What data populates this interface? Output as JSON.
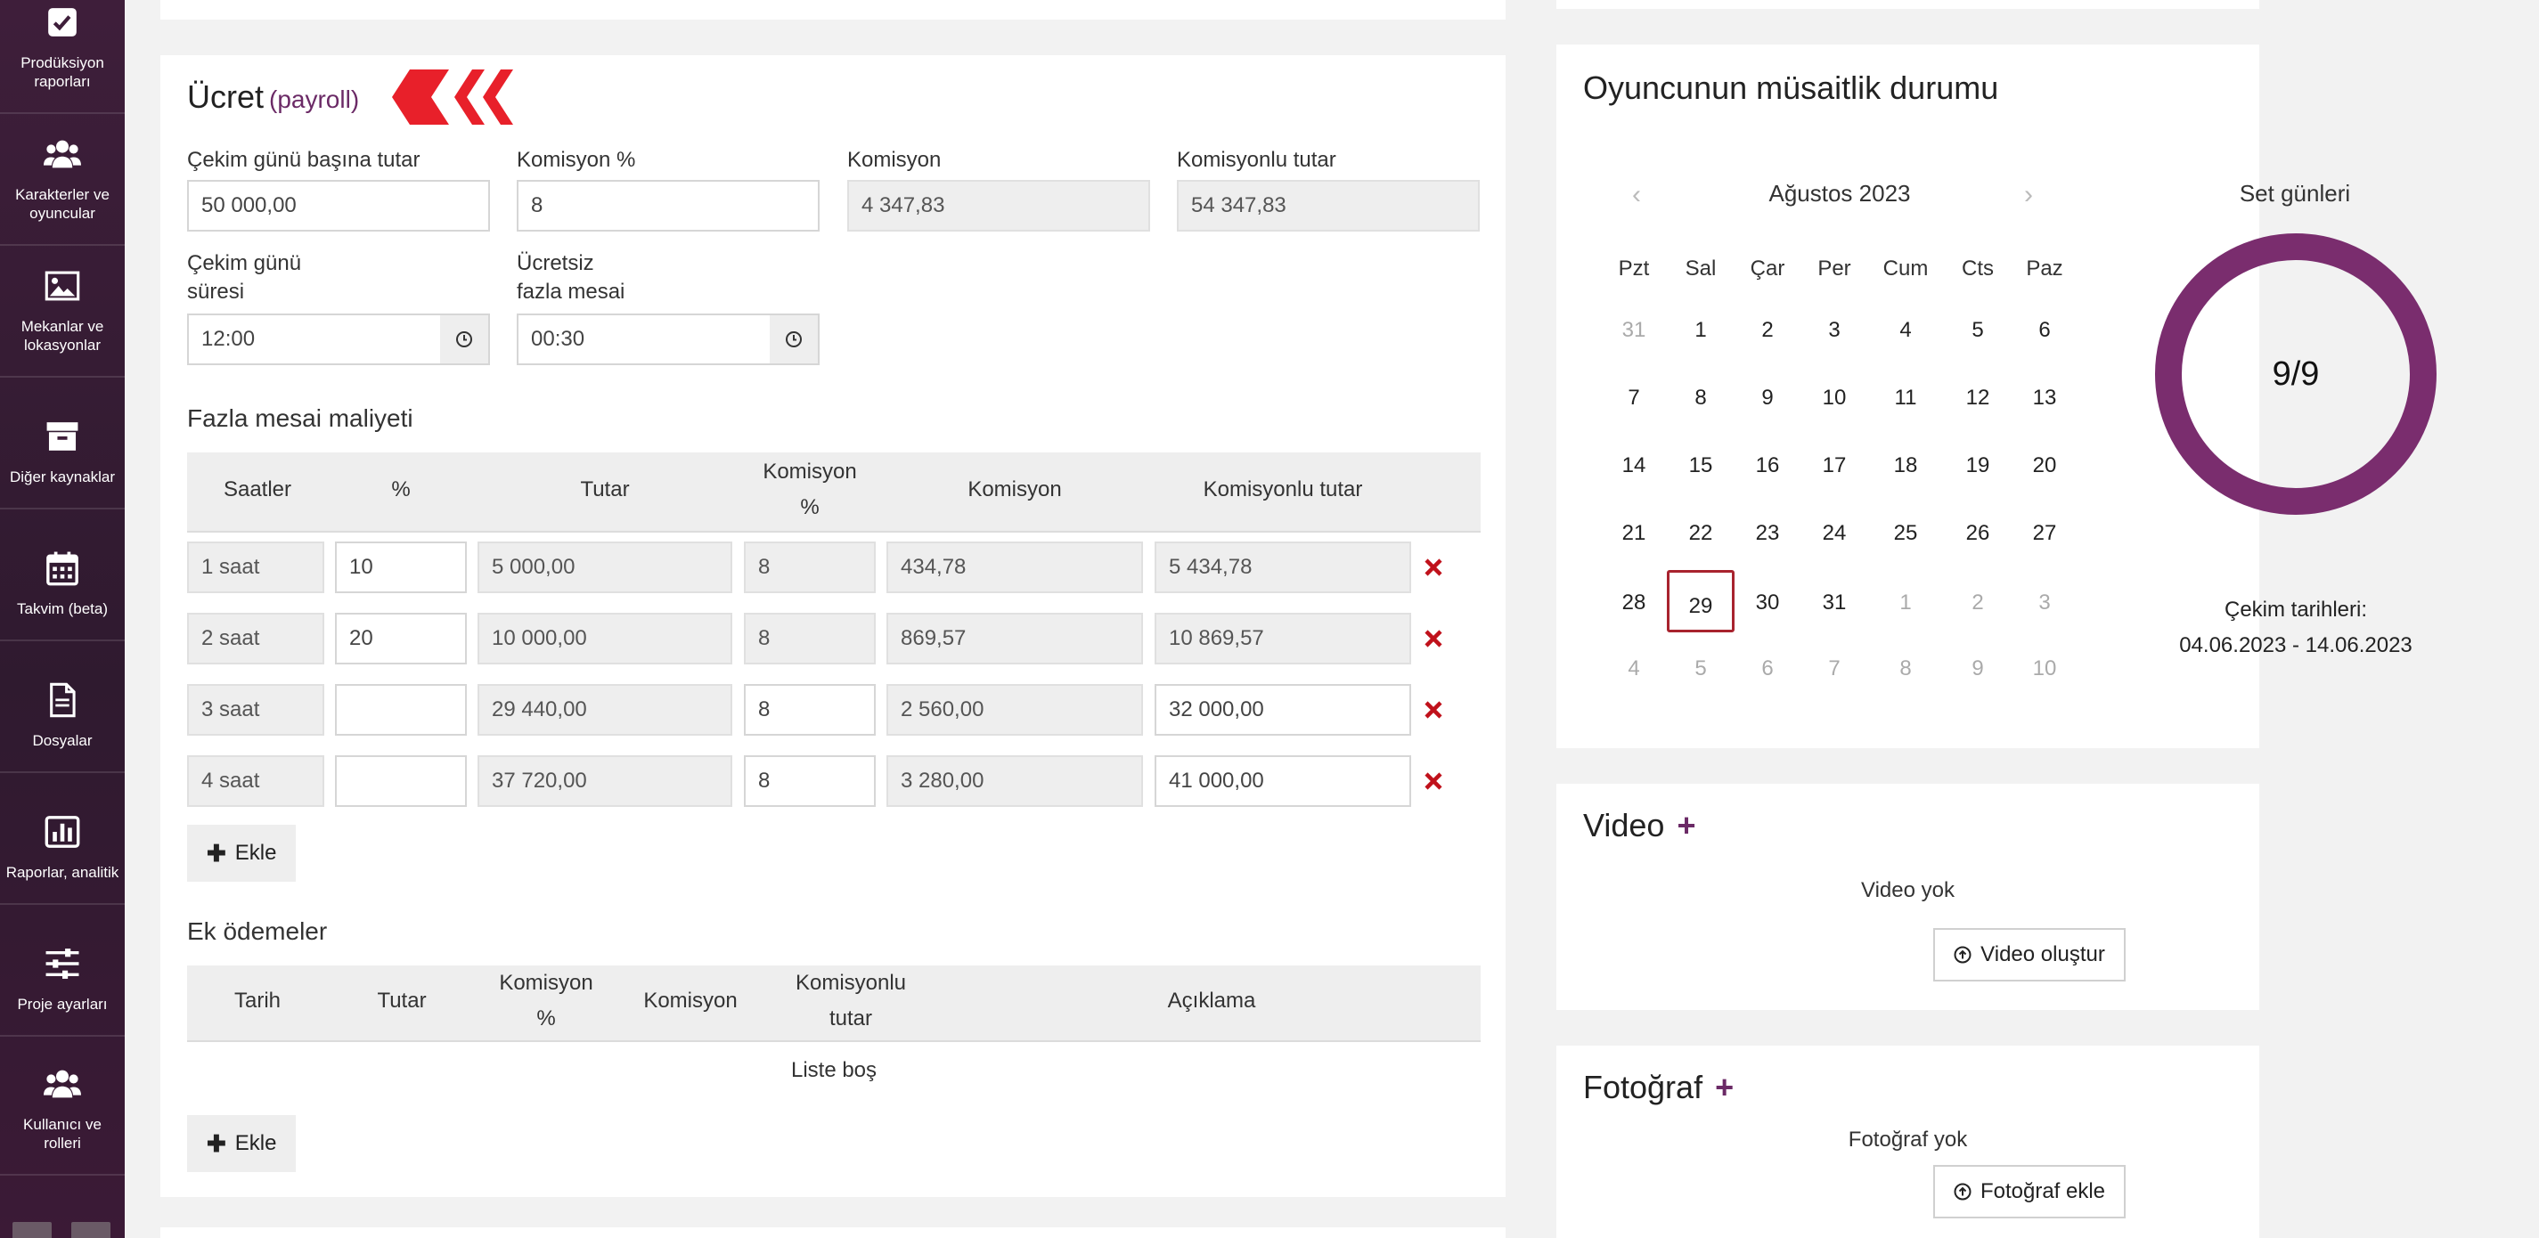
{
  "sidebar": {
    "items": [
      {
        "label": "Prodüksiyon raporları",
        "icon": "checkbox-icon"
      },
      {
        "label": "Karakterler ve oyuncular",
        "icon": "users-icon"
      },
      {
        "label": "Mekanlar ve lokasyonlar",
        "icon": "image-icon"
      },
      {
        "label": "Diğer kaynaklar",
        "icon": "archive-icon"
      },
      {
        "label": "Takvim (beta)",
        "icon": "calendar-icon"
      },
      {
        "label": "Dosyalar",
        "icon": "file-icon"
      },
      {
        "label": "Raporlar, analitik",
        "icon": "bar-chart-icon"
      },
      {
        "label": "Proje ayarları",
        "icon": "sliders-icon"
      },
      {
        "label": "Kullanıcı ve rolleri",
        "icon": "users-icon"
      }
    ]
  },
  "payroll": {
    "title": "Ücret",
    "subtitle": "(payroll)",
    "fields": {
      "daily_rate_label": "Çekim günü başına tutar",
      "daily_rate_value": "50 000,00",
      "commission_pct_label": "Komisyon %",
      "commission_pct_value": "8",
      "commission_label": "Komisyon",
      "commission_value": "4 347,83",
      "total_label": "Komisyonlu tutar",
      "total_value": "54 347,83",
      "duration_label_1": "Çekim günü",
      "duration_label_2": "süresi",
      "duration_value": "12:00",
      "free_ot_label_1": "Ücretsiz",
      "free_ot_label_2": "fazla mesai",
      "free_ot_value": "00:30"
    },
    "overtime": {
      "title": "Fazla mesai maliyeti",
      "headers": {
        "hours": "Saatler",
        "pct": "%",
        "amount": "Tutar",
        "commission_pct_1": "Komisyon",
        "commission_pct_2": "%",
        "commission": "Komisyon",
        "total": "Komisyonlu tutar"
      },
      "rows": [
        {
          "hours": "1 saat",
          "pct": "10",
          "amount": "5 000,00",
          "cpct": "8",
          "commission": "434,78",
          "total": "5 434,78"
        },
        {
          "hours": "2 saat",
          "pct": "20",
          "amount": "10 000,00",
          "cpct": "8",
          "commission": "869,57",
          "total": "10 869,57"
        },
        {
          "hours": "3 saat",
          "pct": "",
          "amount": "29 440,00",
          "cpct": "8",
          "commission": "2 560,00",
          "total": "32 000,00"
        },
        {
          "hours": "4 saat",
          "pct": "",
          "amount": "37 720,00",
          "cpct": "8",
          "commission": "3 280,00",
          "total": "41 000,00"
        }
      ],
      "add_label": "Ekle"
    },
    "extra": {
      "title": "Ek ödemeler",
      "headers": {
        "date": "Tarih",
        "amount": "Tutar",
        "commission_pct_1": "Komisyon",
        "commission_pct_2": "%",
        "commission": "Komisyon",
        "total_1": "Komisyonlu",
        "total_2": "tutar",
        "description": "Açıklama"
      },
      "empty": "Liste boş",
      "add_label": "Ekle"
    }
  },
  "availability": {
    "title": "Oyuncunun müsaitlik durumu",
    "month": "Ağustos 2023",
    "weekdays": [
      "Pzt",
      "Sal",
      "Çar",
      "Per",
      "Cum",
      "Cts",
      "Paz"
    ],
    "weeks": [
      [
        "31",
        "1",
        "2",
        "3",
        "4",
        "5",
        "6"
      ],
      [
        "7",
        "8",
        "9",
        "10",
        "11",
        "12",
        "13"
      ],
      [
        "14",
        "15",
        "16",
        "17",
        "18",
        "19",
        "20"
      ],
      [
        "21",
        "22",
        "23",
        "24",
        "25",
        "26",
        "27"
      ],
      [
        "28",
        "29",
        "30",
        "31",
        "1",
        "2",
        "3"
      ],
      [
        "4",
        "5",
        "6",
        "7",
        "8",
        "9",
        "10"
      ]
    ],
    "set_days_title": "Set günleri",
    "set_days_value": "9/9",
    "shoot_dates_label": "Çekim tarihleri:",
    "shoot_dates_value": "04.06.2023 - 14.06.2023",
    "ring_color": "#7a2d6e",
    "today_border_color": "#a8232e"
  },
  "video": {
    "title": "Video",
    "empty": "Video yok",
    "button": "Video oluştur"
  },
  "photo": {
    "title": "Fotoğraf",
    "empty": "Fotoğraf yok",
    "button": "Fotoğraf ekle"
  },
  "colors": {
    "accent": "#6b2a66",
    "delete": "#c0111b",
    "arrow": "#e8202a"
  }
}
